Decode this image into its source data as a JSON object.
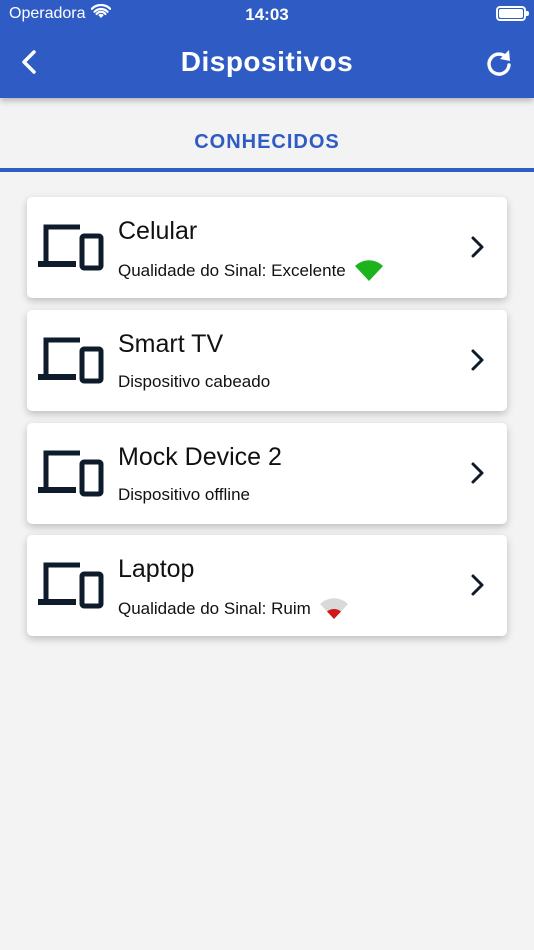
{
  "status_bar": {
    "carrier": "Operadora",
    "time": "14:03"
  },
  "header": {
    "title": "Dispositivos",
    "back_icon": "chevron-left-icon",
    "refresh_icon": "refresh-icon"
  },
  "tab": {
    "label": "CONHECIDOS"
  },
  "devices": [
    {
      "name": "Celular",
      "subtitle": "Qualidade do Sinal: Excelente",
      "signal": "excellent",
      "signal_color": "#1db31d"
    },
    {
      "name": "Smart TV",
      "subtitle": "Dispositivo cabeado"
    },
    {
      "name": "Mock Device 2",
      "subtitle": "Dispositivo offline"
    },
    {
      "name": "Laptop",
      "subtitle": "Qualidade do Sinal: Ruim",
      "signal": "poor",
      "signal_color": "#d0191b"
    }
  ],
  "colors": {
    "primary": "#2f5bc4",
    "background": "#f3f3f3",
    "icon_dark": "#0d1b2a"
  }
}
